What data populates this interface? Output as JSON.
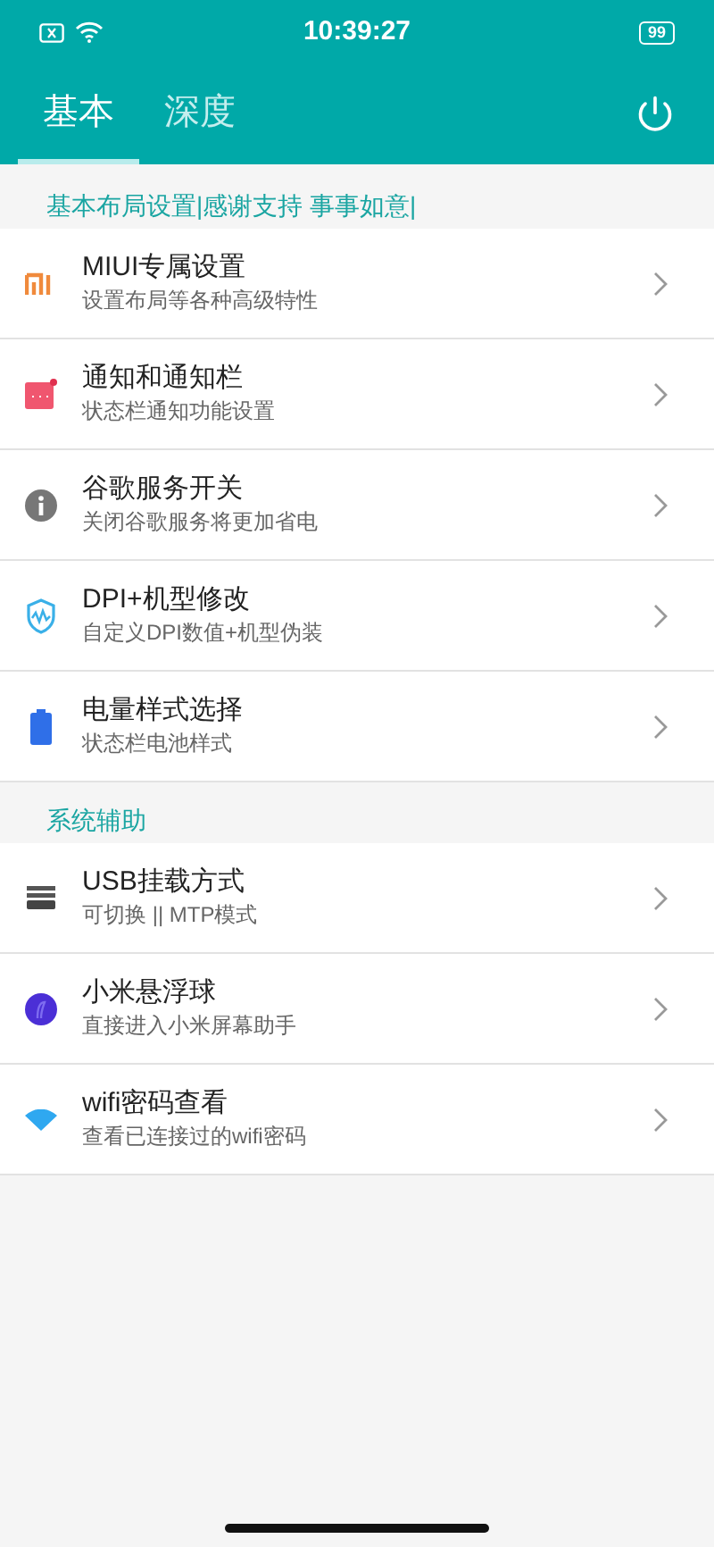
{
  "status_bar": {
    "time": "10:39:27",
    "battery": "99"
  },
  "tabs": [
    {
      "label": "基本",
      "selected": true
    },
    {
      "label": "深度",
      "selected": false
    }
  ],
  "sections": [
    {
      "title": "基本布局设置|感谢支持 事事如意|",
      "items": [
        {
          "kind": "mi",
          "title": "MIUI专属设置",
          "subtitle": "设置布局等各种高级特性"
        },
        {
          "kind": "notice",
          "title": "通知和通知栏",
          "subtitle": "状态栏通知功能设置"
        },
        {
          "kind": "info",
          "title": "谷歌服务开关",
          "subtitle": "关闭谷歌服务将更加省电"
        },
        {
          "kind": "shield",
          "title": "DPI+机型修改",
          "subtitle": "自定义DPI数值+机型伪装"
        },
        {
          "kind": "battery",
          "title": "电量样式选择",
          "subtitle": "状态栏电池样式"
        }
      ]
    },
    {
      "title": "系统辅助",
      "items": [
        {
          "kind": "usb",
          "title": "USB挂载方式",
          "subtitle": "可切换 || MTP模式"
        },
        {
          "kind": "ball",
          "title": "小米悬浮球",
          "subtitle": "直接进入小米屏幕助手"
        },
        {
          "kind": "wifi",
          "title": "wifi密码查看",
          "subtitle": "查看已连接过的wifi密码"
        }
      ]
    }
  ]
}
